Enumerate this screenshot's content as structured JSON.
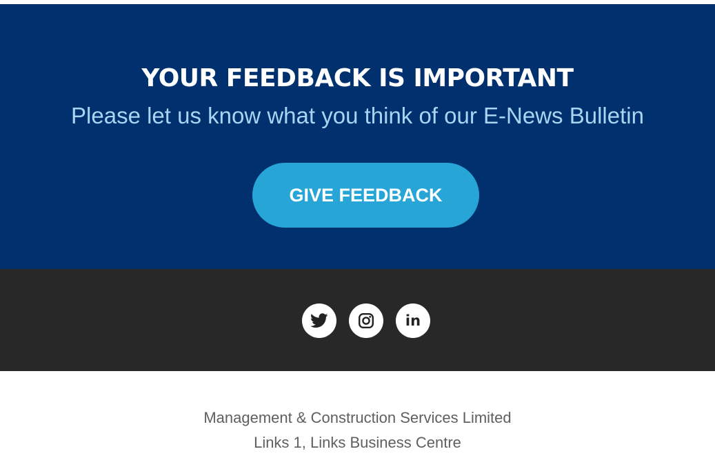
{
  "feedback": {
    "title": "YOUR FEEDBACK IS IMPORTANT",
    "subtitle": "Please let us know what you think of our E-News Bulletin",
    "button_label": "GIVE FEEDBACK"
  },
  "social": {
    "icons": [
      "twitter-icon",
      "instagram-icon",
      "linkedin-icon"
    ],
    "linkedin_text": "in"
  },
  "footer": {
    "company": "Management & Construction Services Limited",
    "address_line": "Links 1, Links Business Centre"
  },
  "colors": {
    "feedback_background": "#00306e",
    "button_background": "#27a5d6",
    "subtitle_text": "#a9d4f2",
    "social_background": "#282828",
    "footer_text": "#5f5f5f"
  }
}
